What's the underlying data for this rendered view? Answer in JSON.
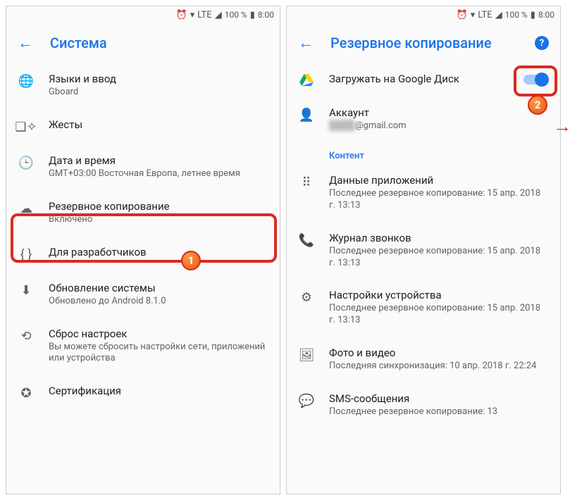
{
  "status": {
    "battery_pct": "100 %",
    "time": "8:00",
    "net": "LTE"
  },
  "left": {
    "title": "Система",
    "items": [
      {
        "icon": "globe",
        "title": "Языки и ввод",
        "sub": "Gboard"
      },
      {
        "icon": "gesture",
        "title": "Жесты",
        "sub": ""
      },
      {
        "icon": "clock",
        "title": "Дата и время",
        "sub": "GMT+03:00 Восточная Европа, летнее время"
      },
      {
        "icon": "cloud-upload",
        "title": "Резервное копирование",
        "sub": "Включено"
      },
      {
        "icon": "braces",
        "title": "Для разработчиков",
        "sub": ""
      },
      {
        "icon": "update",
        "title": "Обновление системы",
        "sub": "Обновлено до Android 8.1.0"
      },
      {
        "icon": "restore",
        "title": "Сброс настроек",
        "sub": "Вы можете сбросить настройки сети, приложений или устройства"
      },
      {
        "icon": "verified",
        "title": "Сертификация",
        "sub": ""
      }
    ]
  },
  "right": {
    "title": "Резервное копирование",
    "top": [
      {
        "icon": "drive",
        "title": "Загружать на Google Диск",
        "sub": ""
      },
      {
        "icon": "person",
        "title": "Аккаунт",
        "sub": "@gmail.com",
        "blurred": true
      }
    ],
    "section": "Контент",
    "content": [
      {
        "icon": "apps",
        "title": "Данные приложений",
        "sub": "Последнее резервное копирование: 15 апр. 2018 г. 13:13"
      },
      {
        "icon": "phone",
        "title": "Журнал звонков",
        "sub": "Последнее резервное копирование: 15 апр. 2018 г. 13:13"
      },
      {
        "icon": "gear",
        "title": "Настройки устройства",
        "sub": "Последнее резервное копирование: 15 апр. 2018 г. 13:13"
      },
      {
        "icon": "image",
        "title": "Фото и видео",
        "sub": "Последняя синхронизация: 10 апр. 2018 г. 22:24"
      },
      {
        "icon": "sms",
        "title": "SMS-сообщения",
        "sub": "Последнее резервное копирование: 13"
      }
    ]
  },
  "badges": {
    "one": "1",
    "two": "2"
  }
}
